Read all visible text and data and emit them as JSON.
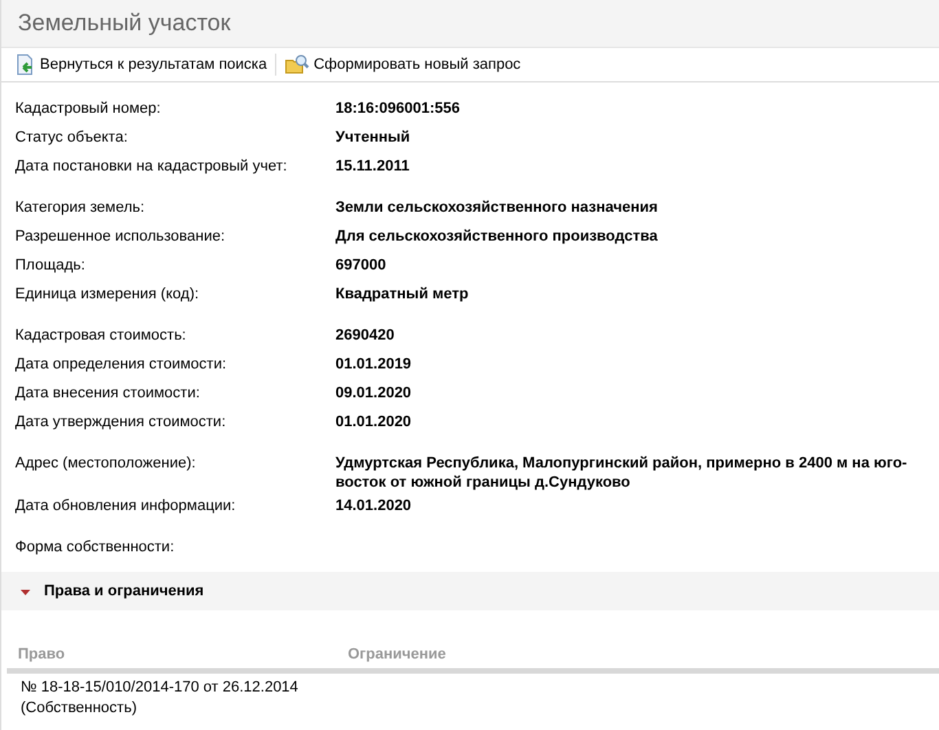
{
  "window": {
    "title": "Земельный участок"
  },
  "toolbar": [
    {
      "label": "Вернуться к результатам поиска",
      "kind": "back"
    },
    {
      "label": "Сформировать новый запрос",
      "kind": "query"
    }
  ],
  "groups": [
    {
      "fields": [
        {
          "label": "Кадастровый номер:",
          "value": "18:16:096001:556"
        },
        {
          "label": "Статус объекта:",
          "value": "Учтенный"
        },
        {
          "label": "Дата постановки на кадастровый учет:",
          "value": "15.11.2011"
        }
      ]
    },
    {
      "fields": [
        {
          "label": "Категория земель:",
          "value": "Земли сельскохозяйственного назначения"
        },
        {
          "label": "Разрешенное использование:",
          "value": "Для сельскохозяйственного производства"
        },
        {
          "label": "Площадь:",
          "value": "697000"
        },
        {
          "label": "Единица измерения (код):",
          "value": "Квадратный метр"
        }
      ]
    },
    {
      "fields": [
        {
          "label": "Кадастровая стоимость:",
          "value": "2690420"
        },
        {
          "label": "Дата определения стоимости:",
          "value": "01.01.2019"
        },
        {
          "label": "Дата внесения стоимости:",
          "value": "09.01.2020"
        },
        {
          "label": "Дата утверждения стоимости:",
          "value": "01.01.2020"
        }
      ]
    },
    {
      "fields": [
        {
          "label": "Адрес (местоположение):",
          "value": "Удмуртская Республика, Малопургинский район, примерно в 2400 м на юго-восток от южной границы д.Сундуково"
        },
        {
          "label": "Дата обновления информации:",
          "value": "14.01.2020"
        }
      ]
    },
    {
      "fields": [
        {
          "label": "Форма собственности:"
        }
      ]
    }
  ],
  "rights": {
    "title": "Права и ограничения",
    "expanded": true,
    "columns": [
      "Право",
      "Ограничение"
    ],
    "rows": [
      {
        "right": "№ 18-18-15/010/2014-170  от 26.12.2014",
        "right_type": "(Собственность)"
      }
    ]
  }
}
